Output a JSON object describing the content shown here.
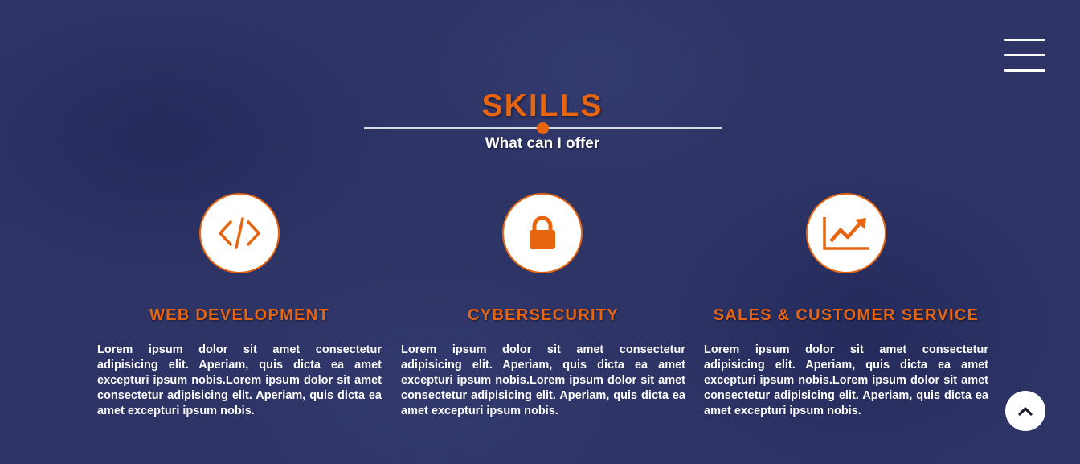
{
  "section": {
    "title": "SKILLS",
    "subtitle": "What can I offer"
  },
  "skills": [
    {
      "icon": "code-icon",
      "title": "WEB DEVELOPMENT",
      "text": "Lorem ipsum dolor sit amet consectetur adipisicing elit. Aperiam, quis dicta ea amet excepturi ipsum nobis.Lorem ipsum dolor sit amet consectetur adipisicing elit. Aperiam, quis dicta ea amet excepturi ipsum nobis."
    },
    {
      "icon": "lock-icon",
      "title": "CYBERSECURITY",
      "text": "Lorem ipsum dolor sit amet consectetur adipisicing elit. Aperiam, quis dicta ea amet excepturi ipsum nobis.Lorem ipsum dolor sit amet consectetur adipisicing elit. Aperiam, quis dicta ea amet excepturi ipsum nobis."
    },
    {
      "icon": "chart-line-icon",
      "title": "SALES & CUSTOMER SERVICE",
      "text": "Lorem ipsum dolor sit amet consectetur adipisicing elit. Aperiam, quis dicta ea amet excepturi ipsum nobis.Lorem ipsum dolor sit amet consectetur adipisicing elit. Aperiam, quis dicta ea amet excepturi ipsum nobis."
    }
  ],
  "controls": {
    "menu_icon": "hamburger-menu-icon",
    "back_to_top_icon": "chevron-up-icon"
  },
  "colors": {
    "background": "#2e3466",
    "accent": "#e8650f",
    "text": "#ffffff"
  }
}
